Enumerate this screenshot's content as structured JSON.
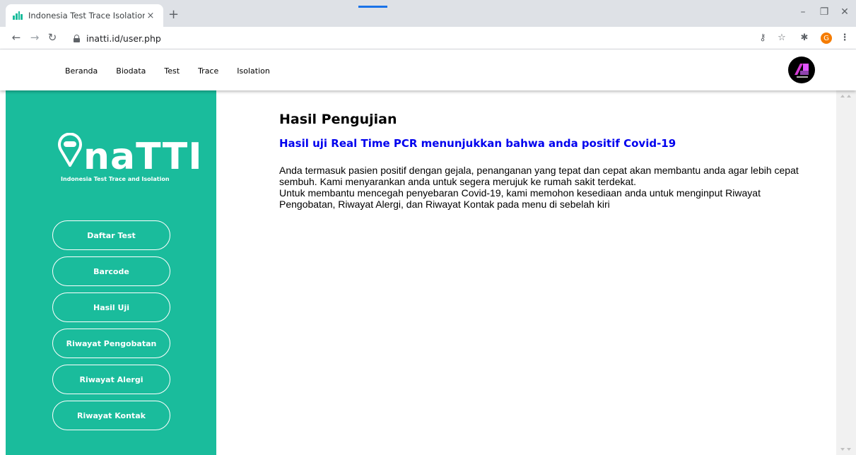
{
  "browser": {
    "tab_title": "Indonesia Test Trace Isolation",
    "tab_close": "×",
    "new_tab": "+",
    "url": "inatti.id/user.php",
    "profile_initial": "G",
    "window": {
      "minimize": "–",
      "maximize": "❐",
      "close": "✕"
    }
  },
  "site_nav": [
    "Beranda",
    "Biodata",
    "Test",
    "Trace",
    "Isolation"
  ],
  "brand": {
    "name": "naTTI",
    "subtitle": "Indonesia Test Trace and Isolation",
    "logo_text": "4"
  },
  "sidebar_buttons": [
    "Daftar Test",
    "Barcode",
    "Hasil Uji",
    "Riwayat Pengobatan",
    "Riwayat Alergi",
    "Riwayat Kontak"
  ],
  "main": {
    "title": "Hasil Pengujian",
    "result": "Hasil uji Real Time PCR menunjukkan bahwa anda positif Covid-19",
    "paragraph1": "Anda termasuk pasien positif dengan gejala, penanganan yang tepat dan cepat akan membantu anda agar lebih cepat sembuh. Kami menyarankan anda untuk segera merujuk ke rumah sakit terdekat.",
    "paragraph2": "Untuk membantu mencegah penyebaran Covid-19, kami memohon kesediaan anda untuk menginput Riwayat Pengobatan, Riwayat Alergi, dan Riwayat Kontak pada menu di sebelah kiri"
  },
  "colors": {
    "sidebar": "#1abc9c",
    "result_text": "#0000ee"
  },
  "icons": [
    "back-icon",
    "forward-icon",
    "reload-icon",
    "lock-icon",
    "key-icon",
    "star-icon",
    "extensions-icon",
    "menu-icon"
  ]
}
